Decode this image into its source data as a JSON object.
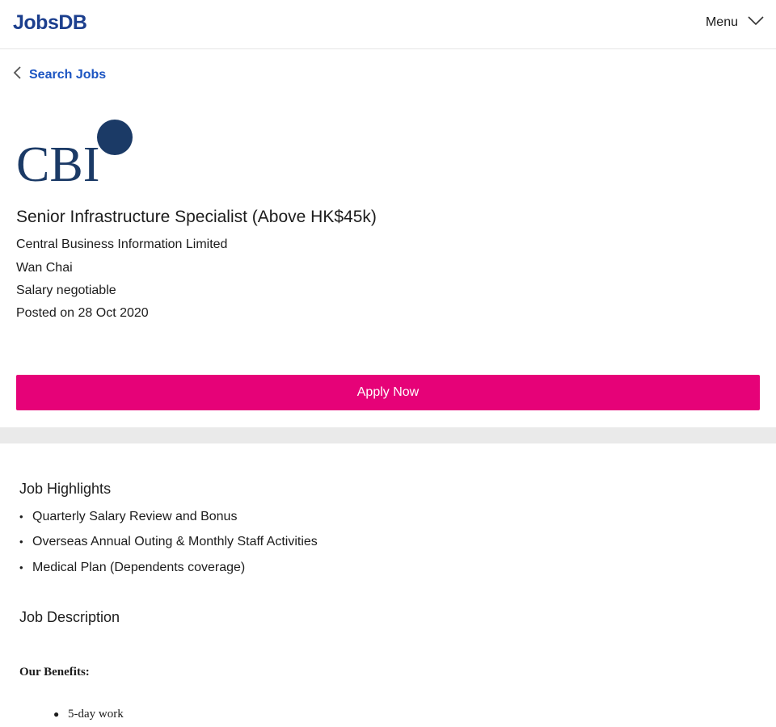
{
  "header": {
    "logo_text": "JobsDB",
    "menu_label": "Menu",
    "menu_icon": "chevron-down-icon"
  },
  "nav": {
    "back_label": "Search Jobs",
    "back_icon": "chevron-left-icon"
  },
  "company_logo": {
    "text": "CBI",
    "color": "#1b3a66"
  },
  "job": {
    "title": "Senior Infrastructure Specialist (Above HK$45k)",
    "company": "Central Business Information Limited",
    "location": "Wan Chai",
    "salary": "Salary negotiable",
    "posted": "Posted on 28 Oct 2020"
  },
  "apply": {
    "label": "Apply Now",
    "color": "#e60278"
  },
  "highlights": {
    "heading": "Job Highlights",
    "items": [
      "Quarterly Salary Review and Bonus",
      "Overseas Annual Outing & Monthly Staff Activities",
      "Medical Plan (Dependents coverage)"
    ]
  },
  "description": {
    "heading": "Job Description",
    "benefits_heading": "Our Benefits:",
    "benefits": [
      "5-day work"
    ]
  },
  "colors": {
    "brand": "#1c3f8e",
    "link": "#1c55c2",
    "accent": "#e60278"
  }
}
